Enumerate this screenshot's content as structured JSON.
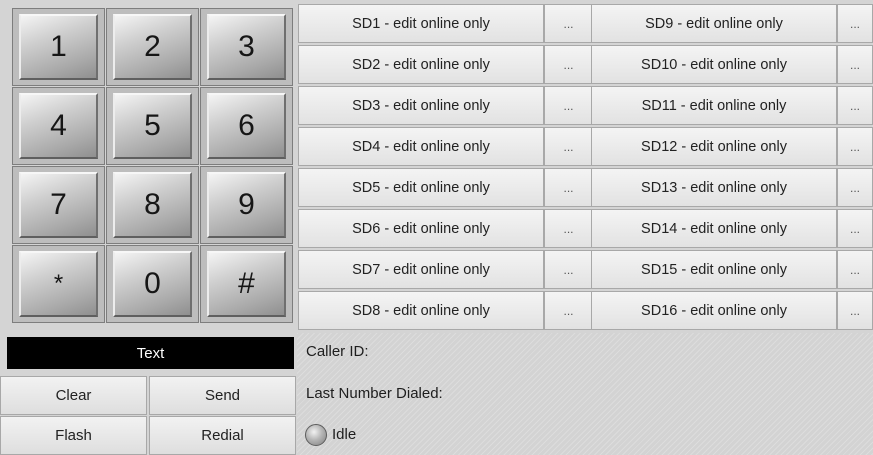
{
  "keypad": {
    "keys": [
      "1",
      "2",
      "3",
      "4",
      "5",
      "6",
      "7",
      "8",
      "9",
      "*",
      "0",
      "#"
    ]
  },
  "speed_dials": {
    "more_label": "...",
    "left": [
      "SD1 - edit online only",
      "SD2 - edit online only",
      "SD3 - edit online only",
      "SD4 - edit online only",
      "SD5 - edit online only",
      "SD6 - edit online only",
      "SD7 - edit online only",
      "SD8 - edit online only"
    ],
    "right": [
      "SD9 - edit online only",
      "SD10 - edit online only",
      "SD11 - edit online only",
      "SD12 - edit online only",
      "SD13 - edit online only",
      "SD14 - edit online only",
      "SD15 - edit online only",
      "SD16 - edit online only"
    ]
  },
  "controls": {
    "text_field": "Text",
    "clear_label": "Clear",
    "send_label": "Send",
    "flash_label": "Flash",
    "redial_label": "Redial"
  },
  "status": {
    "caller_id_label": "Caller ID:",
    "last_number_label": "Last Number Dialed:",
    "state_label": "Idle",
    "indicator_color": "#9a9a9a"
  }
}
